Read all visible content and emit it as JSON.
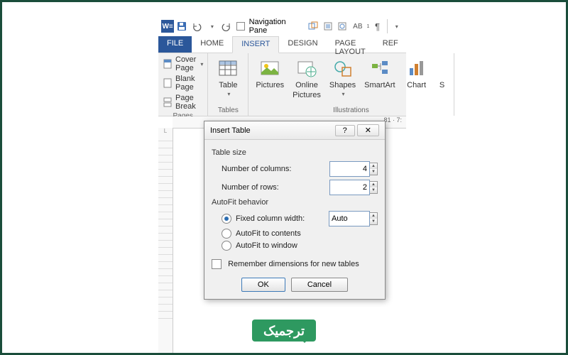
{
  "qat": {
    "nav_pane_label": "Navigation Pane",
    "ab_label": "AB"
  },
  "tabs": {
    "file": "FILE",
    "home": "HOME",
    "insert": "INSERT",
    "design": "DESIGN",
    "page_layout": "PAGE LAYOUT",
    "references": "REF"
  },
  "ribbon": {
    "pages": {
      "cover_page": "Cover Page",
      "blank_page": "Blank Page",
      "page_break": "Page Break",
      "group_label": "Pages"
    },
    "tables": {
      "table": "Table",
      "group_label": "Tables"
    },
    "illustrations": {
      "pictures": "Pictures",
      "online_pictures_l1": "Online",
      "online_pictures_l2": "Pictures",
      "shapes": "Shapes",
      "smartart": "SmartArt",
      "chart": "Chart",
      "screenshot": "S",
      "group_label": "Illustrations"
    }
  },
  "ruler": {
    "text": "81 · 7:"
  },
  "dialog": {
    "title": "Insert Table",
    "group_table_size": "Table size",
    "label_cols": "Number of columns:",
    "value_cols": "4",
    "label_rows": "Number of rows:",
    "value_rows": "2",
    "group_autofit": "AutoFit behavior",
    "opt_fixed": "Fixed column width:",
    "value_fixed": "Auto",
    "opt_contents": "AutoFit to contents",
    "opt_window": "AutoFit to window",
    "checkbox_remember": "Remember dimensions for new tables",
    "btn_ok": "OK",
    "btn_cancel": "Cancel"
  },
  "badge": {
    "text": "ترجمیک"
  }
}
